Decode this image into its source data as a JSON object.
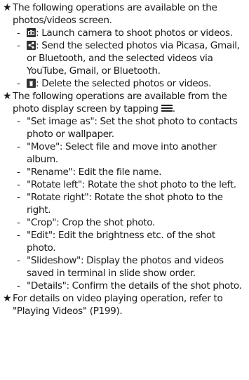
{
  "items": [
    {
      "intro": "The following operations are available on the photos/videos screen.",
      "subs": [
        {
          "icon": "camera-icon",
          "text": ": Launch camera to shoot photos or videos."
        },
        {
          "icon": "share-icon",
          "text": ": Send the selected photos via Picasa, Gmail, or Bluetooth, and the selected videos via YouTube, Gmail, or Bluetooth."
        },
        {
          "icon": "delete-icon",
          "text": ": Delete the selected photos or videos."
        }
      ]
    },
    {
      "intro": "The following operations are available from the photo display screen by tapping",
      "intro_icon": "menu-icon",
      "intro_suffix": ".",
      "subs": [
        {
          "text": "\"Set image as\": Set the shot photo to contacts photo or wallpaper."
        },
        {
          "text": "\"Move\": Select file and move into another album."
        },
        {
          "text": "\"Rename\": Edit the file name."
        },
        {
          "text": "\"Rotate left\": Rotate the shot photo to the left."
        },
        {
          "text": "\"Rotate right\": Rotate the shot photo to the right."
        },
        {
          "text": "\"Crop\": Crop the shot photo."
        },
        {
          "text": "\"Edit\": Edit the brightness etc. of the shot photo."
        },
        {
          "text": "\"Slideshow\": Display the photos and videos saved in terminal in slide show order."
        },
        {
          "text": "\"Details\": Confirm the details of the shot photo."
        }
      ]
    },
    {
      "intro": "For details on video playing operation, refer to \"Playing Videos\" (P199)."
    }
  ],
  "bullet": "★",
  "dash": "-"
}
